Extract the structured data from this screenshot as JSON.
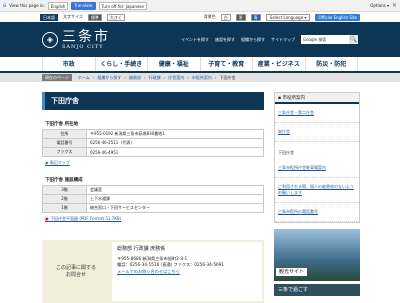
{
  "translate_bar": {
    "view_text": "View this page in:",
    "language": "English",
    "translate_label": "Translate",
    "turn_off": "Turn off for: Japanese",
    "options": "Options ▾",
    "close": "✕"
  },
  "util": {
    "language_label": "日本語",
    "font_size": "文字サイズ",
    "fs_std": "標準",
    "fs_large": "大きく",
    "bg_label": "背景色",
    "bg_white": "白",
    "bg_black": "黒",
    "bg_blue": "青",
    "select_language": "Select Language ▾",
    "official_english": "Official English Site"
  },
  "header": {
    "logo_kanji": "三条市",
    "logo_roman": "SANJO CITY",
    "links": [
      "イベントを探す",
      "施設を探す",
      "組織から探す",
      "サイトマップ"
    ],
    "search_placeholder": "Google 検索",
    "search_button": "🔍"
  },
  "gnav": [
    "市政",
    "くらし・手続き",
    "健康・福祉",
    "子育て・教育",
    "産業・ビジネス",
    "防災・防犯"
  ],
  "breadcrumb": {
    "here": "現在のページ",
    "items": [
      "ホーム",
      "組織から探す",
      "総務部",
      "行政課",
      "庁舎案内",
      "市役所案内"
    ],
    "current": "下田庁舎"
  },
  "page_title": "下田庁舎",
  "location": {
    "heading": "下田庁舎 所在地",
    "rows": [
      {
        "label": "住所",
        "value": "〒955-0192 新潟県三条市荻堀830番地1"
      },
      {
        "label": "電話番号",
        "value": "0256-46-2511（代表）"
      },
      {
        "label": "ファクス",
        "value": "0256-46-4951"
      }
    ],
    "map_link": "周辺マップ"
  },
  "floors": {
    "heading": "下田庁舎 施設構成",
    "rows": [
      {
        "label": "3階",
        "value": "会議室"
      },
      {
        "label": "2階",
        "value": "上下水道課"
      },
      {
        "label": "1階",
        "value": "総合窓口・下田サービスセンター"
      }
    ],
    "pdf_link": "下田庁舎平面図 (PDF Format 51.7KB)"
  },
  "contact": {
    "label": "この記事に関する\nお問合せ",
    "dept": "総務部 行政課 庶務係",
    "address": "〒955-8686 新潟県三条市旭町2-3-1",
    "phone": "電話：0256-34-5516 (直通) ファクス：0256-34-5691",
    "mail": "メールでのお問い合わせはこちら"
  },
  "side": {
    "title": "市役所案内",
    "items": [
      "三条庁舎・第二庁舎",
      "栄庁舎"
    ],
    "section": "下田庁舎",
    "items2": [
      "三条市役所庁舎駐車場案内",
      "ご利用される際、個人の被害宛のないようお願いします",
      "三条市役所の電話番号"
    ],
    "ad_caption": "観光サイト",
    "ad2_caption": "三条で過ごす"
  }
}
